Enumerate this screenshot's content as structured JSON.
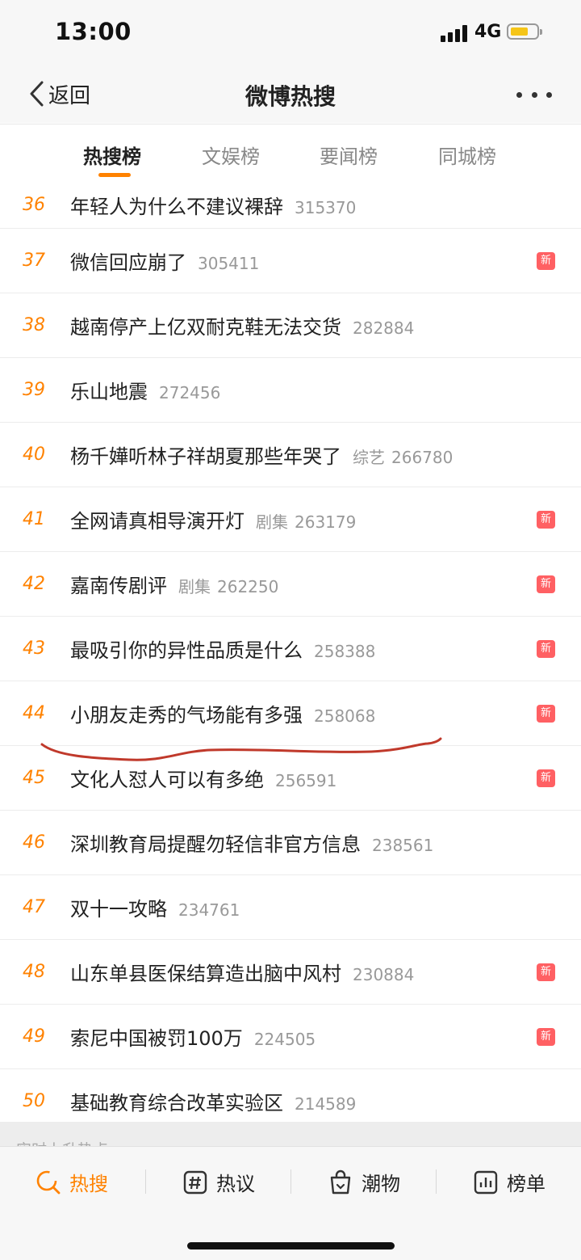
{
  "status_bar": {
    "time": "13:00",
    "network": "4G"
  },
  "nav": {
    "back_label": "返回",
    "title": "微博热搜"
  },
  "tabs": [
    {
      "label": "热搜榜",
      "active": true
    },
    {
      "label": "文娱榜",
      "active": false
    },
    {
      "label": "要闻榜",
      "active": false
    },
    {
      "label": "同城榜",
      "active": false
    }
  ],
  "list": [
    {
      "rank": "36",
      "title": "年轻人为什么不建议裸辞",
      "category": "",
      "count": "315370",
      "badge": ""
    },
    {
      "rank": "37",
      "title": "微信回应崩了",
      "category": "",
      "count": "305411",
      "badge": "新"
    },
    {
      "rank": "38",
      "title": "越南停产上亿双耐克鞋无法交货",
      "category": "",
      "count": "282884",
      "badge": ""
    },
    {
      "rank": "39",
      "title": "乐山地震",
      "category": "",
      "count": "272456",
      "badge": ""
    },
    {
      "rank": "40",
      "title": "杨千嬅听林子祥胡夏那些年哭了",
      "category": "综艺",
      "count": "266780",
      "badge": ""
    },
    {
      "rank": "41",
      "title": "全网请真相导演开灯",
      "category": "剧集",
      "count": "263179",
      "badge": "新"
    },
    {
      "rank": "42",
      "title": "嘉南传剧评",
      "category": "剧集",
      "count": "262250",
      "badge": "新"
    },
    {
      "rank": "43",
      "title": "最吸引你的异性品质是什么",
      "category": "",
      "count": "258388",
      "badge": "新"
    },
    {
      "rank": "44",
      "title": "小朋友走秀的气场能有多强",
      "category": "",
      "count": "258068",
      "badge": "新"
    },
    {
      "rank": "45",
      "title": "文化人怼人可以有多绝",
      "category": "",
      "count": "256591",
      "badge": "新"
    },
    {
      "rank": "46",
      "title": "深圳教育局提醒勿轻信非官方信息",
      "category": "",
      "count": "238561",
      "badge": ""
    },
    {
      "rank": "47",
      "title": "双十一攻略",
      "category": "",
      "count": "234761",
      "badge": ""
    },
    {
      "rank": "48",
      "title": "山东单县医保结算造出脑中风村",
      "category": "",
      "count": "230884",
      "badge": "新"
    },
    {
      "rank": "49",
      "title": "索尼中国被罚100万",
      "category": "",
      "count": "224505",
      "badge": "新"
    },
    {
      "rank": "50",
      "title": "基础教育综合改革实验区",
      "category": "",
      "count": "214589",
      "badge": ""
    }
  ],
  "section": {
    "label": "实时上升热点"
  },
  "bottom_tabs": [
    {
      "label": "热搜",
      "icon": "hot-search-icon",
      "active": true
    },
    {
      "label": "热议",
      "icon": "hashtag-icon",
      "active": false
    },
    {
      "label": "潮物",
      "icon": "shopping-bag-icon",
      "active": false
    },
    {
      "label": "榜单",
      "icon": "chart-list-icon",
      "active": false
    }
  ],
  "colors": {
    "accent": "#ff8200",
    "badge": "#ff6063",
    "rank": "#ff8200",
    "annotation": "#c0392b"
  }
}
